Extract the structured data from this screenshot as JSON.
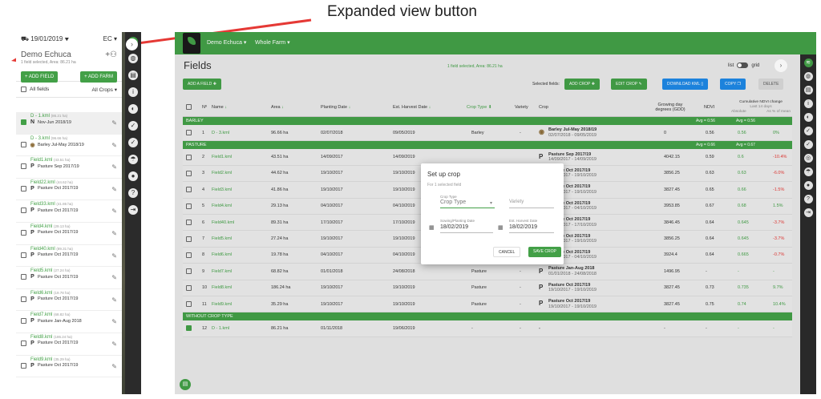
{
  "annotation": {
    "label": "Expanded view button"
  },
  "side_panel": {
    "date": "19/01/2019",
    "ec": "EC",
    "farm_name": "Demo Echuca",
    "selected_info": "1 field selected, Area: 86.21 ha",
    "add_field": "ADD FIELD",
    "add_farm": "ADD FARM",
    "all_fields": "All fields",
    "all_crops": "All Crops",
    "items": [
      {
        "name": "D - 1.kml",
        "area": "(86.21 ha)",
        "crop": "Nov-Jun 2018/19",
        "icon": "N",
        "selected": true
      },
      {
        "name": "D - 3.kml",
        "area": "(96.66 ha)",
        "crop": "Barley Jul-May 2018/19",
        "icon": "globe",
        "selected": false
      },
      {
        "name": "Field1.kml",
        "area": "(43.51 ha)",
        "crop": "Pasture Sep 2017/19",
        "icon": "P",
        "selected": false
      },
      {
        "name": "Field22.kml",
        "area": "(44.62 ha)",
        "crop": "Pasture Oct 2017/19",
        "icon": "P",
        "selected": false
      },
      {
        "name": "Field33.kml",
        "area": "(41.86 ha)",
        "crop": "Pasture Oct 2017/19",
        "icon": "P",
        "selected": false
      },
      {
        "name": "Field4.kml",
        "area": "(29.13 ha)",
        "crop": "Pasture Oct 2017/19",
        "icon": "P",
        "selected": false
      },
      {
        "name": "Field40.kml",
        "area": "(89.31 ha)",
        "crop": "Pasture Oct 2017/19",
        "icon": "P",
        "selected": false
      },
      {
        "name": "Field5.kml",
        "area": "(27.24 ha)",
        "crop": "Pasture Oct 2017/19",
        "icon": "P",
        "selected": false
      },
      {
        "name": "Field6.kml",
        "area": "(19.78 ha)",
        "crop": "Pasture Oct 2017/19",
        "icon": "P",
        "selected": false
      },
      {
        "name": "Field7.kml",
        "area": "(68.82 ha)",
        "crop": "Pasture Jan-Aug 2018",
        "icon": "P",
        "selected": false
      },
      {
        "name": "Field8.kml",
        "area": "(186.24 ha)",
        "crop": "Pasture Oct 2017/19",
        "icon": "P",
        "selected": false
      },
      {
        "name": "Field9.kml",
        "area": "(35.29 ha)",
        "crop": "Pasture Oct 2017/19",
        "icon": "P",
        "selected": false
      }
    ]
  },
  "topbar": {
    "farm": "Demo Echuca",
    "scope": "Whole Farm"
  },
  "page": {
    "title": "Fields",
    "selection_info": "1 field selected, Area: 86.21 ha",
    "list_label": "list",
    "grid_label": "grid"
  },
  "toolbar": {
    "add_field": "ADD A FIELD",
    "selected_fields": "Selected fields:",
    "add_crop": "ADD CROP",
    "edit_crop": "EDIT CROP",
    "download_kml": "DOWNLOAD KML",
    "copy": "COPY",
    "delete": "DELETE"
  },
  "table": {
    "headers": {
      "no": "Nº",
      "name": "Name",
      "area": "Area",
      "planting": "Planting Date",
      "harvest": "Est. Harvest Date",
      "crop_type": "Crop Type",
      "variety": "Variety",
      "crop": "Crop",
      "gdd": "Growing day degrees (GDD)",
      "ndvi": "NDVI",
      "cum": "Cumulative NDVI change",
      "cum_sub": "Last 14 days",
      "absolute": "Absolute",
      "as_mean": "As % of mean"
    },
    "groups": [
      {
        "name": "BARLEY",
        "avg1": "Avg = 0.56",
        "avg2": "Avg = 0.56",
        "rows": [
          {
            "n": "1",
            "name": "D - 3.kml",
            "area": "96.66 ha",
            "plant": "02/07/2018",
            "harvest": "09/05/2019",
            "type": "Barley",
            "variety": "-",
            "crop": "Barley Jul-May 2018/19",
            "crop_dates": "02/07/2018 - 09/05/2019",
            "gdd": "0",
            "ndvi": "0.56",
            "abs": "0.56",
            "pct": "0%",
            "pct_neg": false
          }
        ]
      },
      {
        "name": "PASTURE",
        "avg1": "Avg = 0.66",
        "avg2": "Avg = 0.67",
        "rows": [
          {
            "n": "2",
            "name": "Field1.kml",
            "area": "43.51 ha",
            "plant": "14/09/2017",
            "harvest": "14/09/2019",
            "type": "",
            "variety": "",
            "crop": "Pasture Sep 2017/19",
            "crop_dates": "14/09/2017 - 14/09/2019",
            "gdd": "4042.15",
            "ndvi": "0.59",
            "abs": "0.6",
            "pct": "-10.4%",
            "pct_neg": true
          },
          {
            "n": "3",
            "name": "Field2.kml",
            "area": "44.62 ha",
            "plant": "19/10/2017",
            "harvest": "19/10/2019",
            "type": "",
            "variety": "",
            "crop": "Pasture Oct 2017/19",
            "crop_dates": "19/10/2017 - 19/10/2019",
            "gdd": "3856.25",
            "ndvi": "0.63",
            "abs": "0.63",
            "pct": "-6.0%",
            "pct_neg": true
          },
          {
            "n": "4",
            "name": "Field3.kml",
            "area": "41.86 ha",
            "plant": "19/10/2017",
            "harvest": "19/10/2019",
            "type": "",
            "variety": "",
            "crop": "Pasture Oct 2017/19",
            "crop_dates": "19/10/2017 - 19/10/2019",
            "gdd": "3827.45",
            "ndvi": "0.65",
            "abs": "0.66",
            "pct": "-1.5%",
            "pct_neg": true
          },
          {
            "n": "5",
            "name": "Field4.kml",
            "area": "29.13 ha",
            "plant": "04/10/2017",
            "harvest": "04/10/2019",
            "type": "",
            "variety": "",
            "crop": "Pasture Oct 2017/19",
            "crop_dates": "04/10/2017 - 04/10/2019",
            "gdd": "3953.85",
            "ndvi": "0.67",
            "abs": "0.68",
            "pct": "1.5%",
            "pct_neg": false
          },
          {
            "n": "6",
            "name": "Field40.kml",
            "area": "89.31 ha",
            "plant": "17/10/2017",
            "harvest": "17/10/2019",
            "type": "",
            "variety": "",
            "crop": "Pasture Oct 2017/19",
            "crop_dates": "17/10/2017 - 17/10/2019",
            "gdd": "3846.45",
            "ndvi": "0.64",
            "abs": "0.645",
            "pct": "-3.7%",
            "pct_neg": true
          },
          {
            "n": "7",
            "name": "Field5.kml",
            "area": "27.24 ha",
            "plant": "19/10/2017",
            "harvest": "19/10/2019",
            "type": "",
            "variety": "",
            "crop": "Pasture Oct 2017/19",
            "crop_dates": "19/10/2017 - 19/10/2019",
            "gdd": "3856.25",
            "ndvi": "0.64",
            "abs": "0.645",
            "pct": "-3.7%",
            "pct_neg": true
          },
          {
            "n": "8",
            "name": "Field6.kml",
            "area": "19.78 ha",
            "plant": "04/10/2017",
            "harvest": "04/10/2019",
            "type": "",
            "variety": "",
            "crop": "Pasture Oct 2017/19",
            "crop_dates": "04/10/2017 - 04/10/2019",
            "gdd": "3924.4",
            "ndvi": "0.64",
            "abs": "0.665",
            "pct": "-0.7%",
            "pct_neg": true
          },
          {
            "n": "9",
            "name": "Field7.kml",
            "area": "68.82 ha",
            "plant": "01/01/2018",
            "harvest": "24/08/2018",
            "type": "Pasture",
            "variety": "-",
            "crop": "Pasture Jan-Aug 2018",
            "crop_dates": "01/01/2018 - 24/08/2018",
            "gdd": "1496.95",
            "ndvi": "-",
            "abs": "-",
            "pct": "-",
            "pct_neg": false
          },
          {
            "n": "10",
            "name": "Field8.kml",
            "area": "186.24 ha",
            "plant": "19/10/2017",
            "harvest": "19/10/2019",
            "type": "Pasture",
            "variety": "-",
            "crop": "Pasture Oct 2017/19",
            "crop_dates": "19/10/2017 - 19/10/2019",
            "gdd": "3827.45",
            "ndvi": "0.73",
            "abs": "0.735",
            "pct": "9.7%",
            "pct_neg": false
          },
          {
            "n": "11",
            "name": "Field9.kml",
            "area": "35.29 ha",
            "plant": "19/10/2017",
            "harvest": "19/10/2019",
            "type": "Pasture",
            "variety": "-",
            "crop": "Pasture Oct 2017/19",
            "crop_dates": "19/10/2017 - 19/10/2019",
            "gdd": "3827.45",
            "ndvi": "0.75",
            "abs": "0.74",
            "pct": "10.4%",
            "pct_neg": false
          }
        ]
      },
      {
        "name": "WITHOUT CROP TYPE",
        "avg1": "",
        "avg2": "",
        "rows": [
          {
            "n": "12",
            "name": "D - 1.kml",
            "area": "86.21 ha",
            "plant": "01/11/2018",
            "harvest": "19/06/2019",
            "type": "-",
            "variety": "-",
            "crop": "-",
            "crop_dates": "",
            "gdd": "-",
            "ndvi": "-",
            "abs": "-",
            "pct": "-",
            "pct_neg": false,
            "checked": true
          }
        ]
      }
    ]
  },
  "modal": {
    "title": "Set up crop",
    "subtitle": "For 1 selected field",
    "crop_type_label": "Crop Type",
    "crop_type_value": "Crop Type",
    "variety_placeholder": "Variety",
    "sowing_label": "Sowing/Planting Date",
    "sowing_value": "18/02/2019",
    "harvest_label": "Est. Harvest Date",
    "harvest_value": "18/02/2019",
    "cancel": "CANCEL",
    "save": "SAVE CROP"
  },
  "colors": {
    "accent": "#43a047",
    "blue": "#1e88e5",
    "negative": "#e53935"
  }
}
